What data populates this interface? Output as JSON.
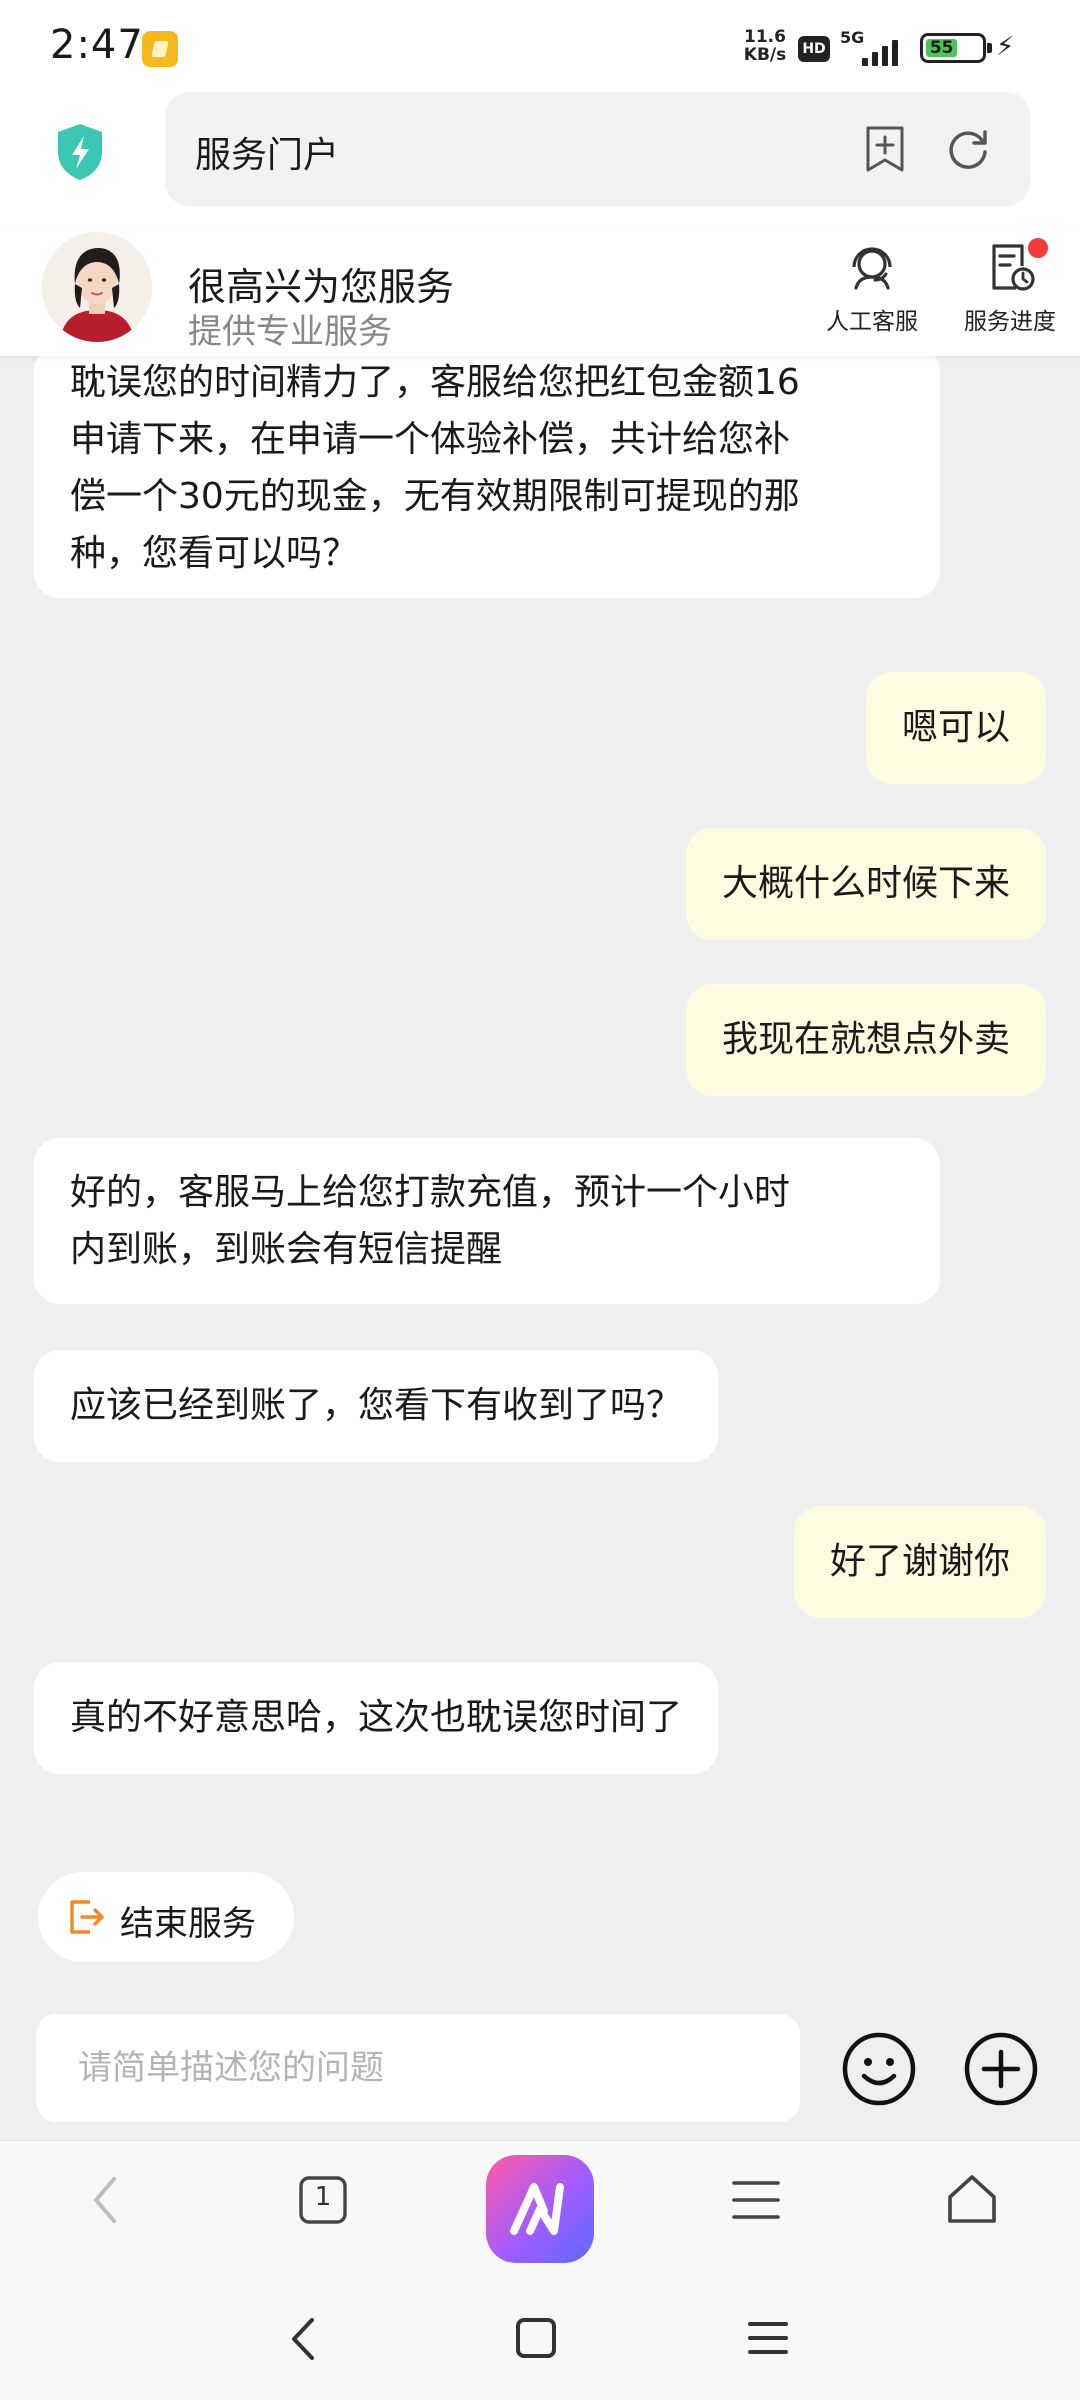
{
  "status_bar": {
    "time": "2:47",
    "net_speed_value": "11.6",
    "net_speed_unit": "KB/s",
    "hd_label": "HD",
    "network_type": "5G",
    "battery_level": "55"
  },
  "header": {
    "search_text": "服务门户"
  },
  "agent": {
    "name": "很高兴为您服务",
    "subtitle": "提供专业服务",
    "human_service_label": "人工客服",
    "progress_label": "服务进度"
  },
  "messages": [
    {
      "sender": "agent",
      "text": "耽误您的时间精力了，客服给您把红包金额16\n申请下来，在申请一个体验补偿，共计给您补\n偿一个30元的现金，无有效期限制可提现的那\n种，您看可以吗？"
    },
    {
      "sender": "user",
      "text": "嗯可以"
    },
    {
      "sender": "user",
      "text": "大概什么时候下来"
    },
    {
      "sender": "user",
      "text": "我现在就想点外卖"
    },
    {
      "sender": "agent",
      "text": "好的，客服马上给您打款充值，预计一个小时\n内到账，到账会有短信提醒"
    },
    {
      "sender": "agent",
      "text": "应该已经到账了，您看下有收到了吗？"
    },
    {
      "sender": "user",
      "text": "好了谢谢你"
    },
    {
      "sender": "agent",
      "text": "真的不好意思哈，这次也耽误您时间了"
    }
  ],
  "quick_actions": {
    "end_service_label": "结束服务"
  },
  "input": {
    "placeholder": "请简单描述您的问题"
  },
  "browser_bar": {
    "tab_count": "1"
  },
  "colors": {
    "agent_bubble": "#ffffff",
    "user_bubble": "#fdfbe0",
    "chat_background": "#efefef",
    "shield_accent": "#3cc6b4",
    "end_service_icon": "#f08a24",
    "notification_dot": "#f23b3b"
  },
  "icons": {
    "shield": "shield-bolt-icon",
    "add_bookmark": "add-bookmark-icon",
    "refresh": "refresh-icon",
    "human_service": "headset-icon",
    "service_progress": "progress-clock-icon",
    "end_service": "exit-icon",
    "emoji": "emoji-icon",
    "plus": "plus-circle-icon"
  }
}
